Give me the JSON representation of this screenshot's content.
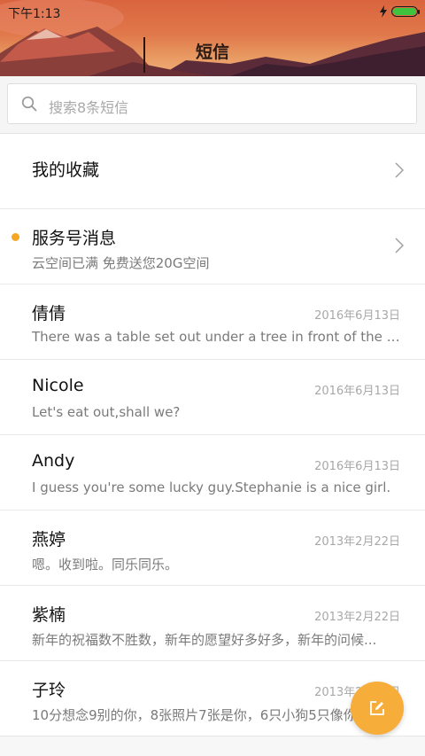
{
  "status_bar": {
    "time": "下午1:13",
    "battery_level": 1.0
  },
  "header": {
    "title": "短信"
  },
  "search": {
    "placeholder": "搜索8条短信"
  },
  "pinned": [
    {
      "title": "我的收藏",
      "subtitle": ""
    },
    {
      "title": "服务号消息",
      "subtitle": "云空间已满 免费送您20G空间",
      "unread_color": "#f5a623"
    }
  ],
  "conversations": [
    {
      "name": "倩倩",
      "date": "2016年6月13日",
      "preview": "There was a table set out under a tree in front of the ho..."
    },
    {
      "name": "Nicole",
      "date": "2016年6月13日",
      "preview": "Let's eat out,shall we?"
    },
    {
      "name": "Andy",
      "date": "2016年6月13日",
      "preview": "I guess you're some lucky guy.Stephanie is a nice girl."
    },
    {
      "name": "燕婷",
      "date": "2013年2月22日",
      "preview": "嗯。收到啦。同乐同乐。"
    },
    {
      "name": "紫楠",
      "date": "2013年2月22日",
      "preview": "新年的祝福数不胜数，新年的愿望好多好多，新年的问候..."
    },
    {
      "name": "子玲",
      "date": "2013年2月22日",
      "preview": "10分想念9别的你，8张照片7张是你，6只小狗5只像你..."
    }
  ],
  "colors": {
    "accent": "#f6ad3a",
    "unread": "#f5a623",
    "battery": "#3ec33e"
  },
  "icons": {
    "search": "search-icon",
    "chevron": "chevron-right-icon",
    "compose": "compose-icon",
    "charging": "bolt-icon"
  }
}
